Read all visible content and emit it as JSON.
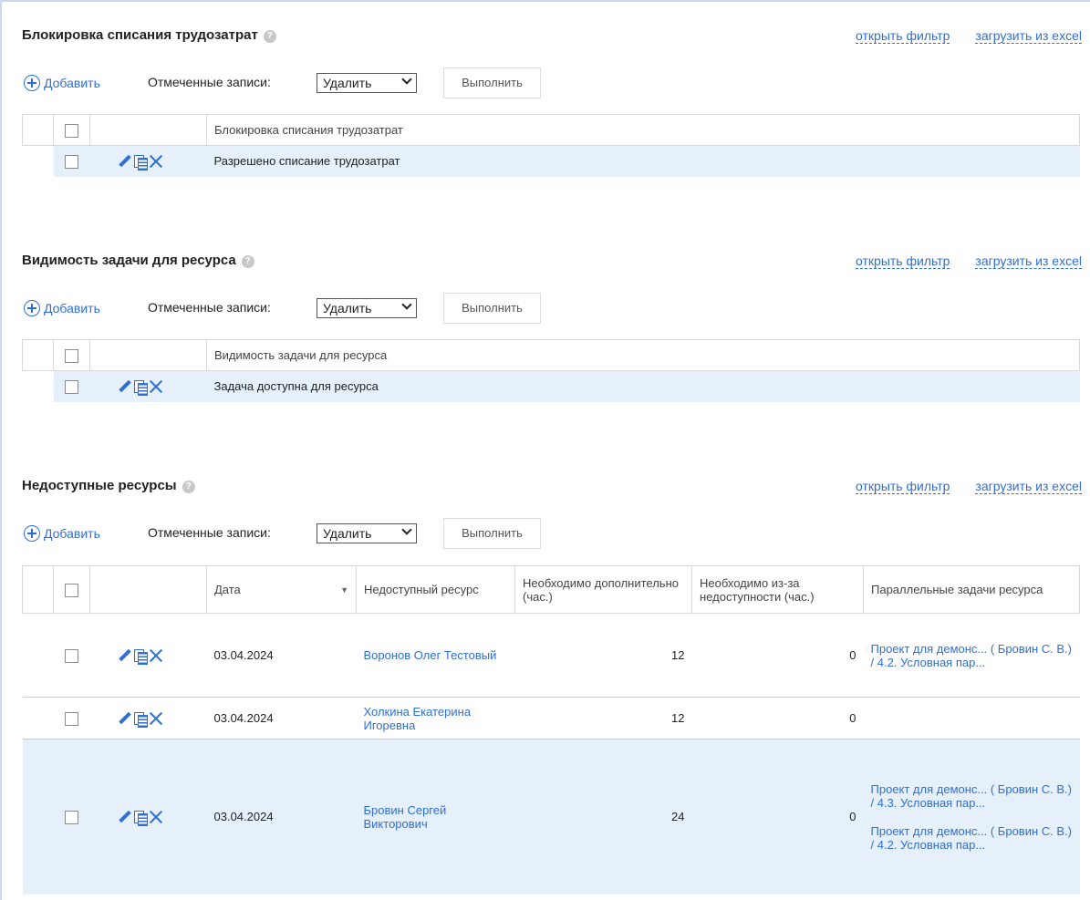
{
  "common": {
    "open_filter": "открыть фильтр",
    "load_excel": "загрузить из excel",
    "add": "Добавить",
    "marked": "Отмеченные записи:",
    "action": "Удалить",
    "execute": "Выполнить",
    "help": "?"
  },
  "section1": {
    "title": "Блокировка списания трудозатрат",
    "header": "Блокировка списания трудозатрат",
    "rows": [
      "Разрешено списание трудозатрат"
    ]
  },
  "section2": {
    "title": "Видимость задачи для ресурса",
    "header": "Видимость задачи для ресурса",
    "rows": [
      "Задача доступна для ресурса"
    ]
  },
  "section3": {
    "title": "Недоступные ресурсы",
    "columns": {
      "date": "Дата",
      "resource": "Недоступный ресурс",
      "extra": "Необходимо дополнительно (час.)",
      "unavail": "Необходимо из-за недоступности (час.)",
      "parallel": "Параллельные задачи ресурса"
    },
    "rows": [
      {
        "date": "03.04.2024",
        "resource": "Воронов Олег Тестовый",
        "extra": "12",
        "unavail": "0",
        "parallel": [
          "Проект для демонс... ( Бровин С. В.) / 4.2. Условная пар..."
        ]
      },
      {
        "date": "03.04.2024",
        "resource": "Холкина Екатерина Игоревна",
        "extra": "12",
        "unavail": "0",
        "parallel": []
      },
      {
        "date": "03.04.2024",
        "resource": "Бровин Сергей Викторович",
        "extra": "24",
        "unavail": "0",
        "parallel": [
          "Проект для демонс... ( Бровин С. В.) / 4.3. Условная пар...",
          "Проект для демонс... ( Бровин С. В.) / 4.2. Условная пар..."
        ]
      }
    ]
  },
  "colors": {
    "link": "#2f6fd6",
    "row_highlight": "#e6f0fb",
    "border": "#dadada"
  }
}
